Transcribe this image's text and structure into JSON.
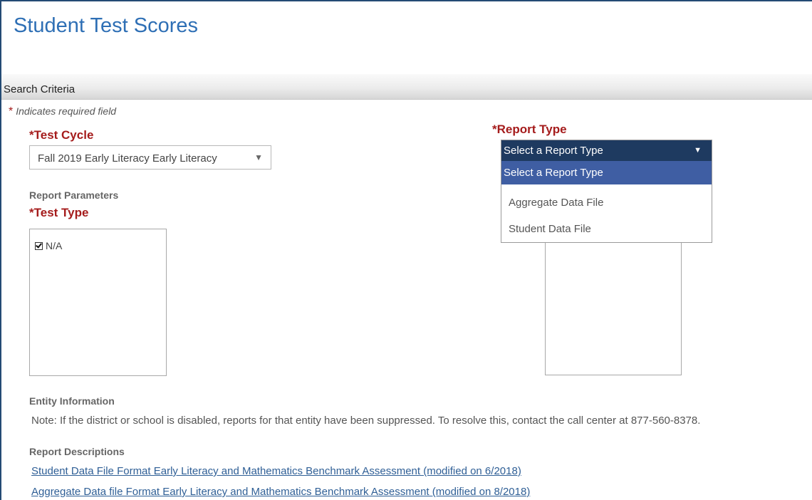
{
  "page": {
    "title": "Student Test Scores"
  },
  "section": {
    "title": "Search Criteria"
  },
  "required_note": {
    "star": "*",
    "text": "Indicates required field"
  },
  "test_cycle": {
    "label": "*Test Cycle",
    "selected": "Fall 2019 Early Literacy Early Literacy",
    "arrow_icon": "▼"
  },
  "report_parameters": {
    "heading": "Report Parameters"
  },
  "test_type": {
    "label": "*Test Type",
    "items": [
      {
        "label": "N/A",
        "checked": true
      }
    ]
  },
  "report_type": {
    "label": "*Report Type",
    "selected": "Select a Report Type",
    "arrow_icon": "▼",
    "options": [
      "Select a Report Type",
      "Aggregate Data File",
      "Student Data File"
    ]
  },
  "entity_information": {
    "heading": "Entity Information",
    "note": "Note: If the district or school is disabled, reports for that entity have been suppressed. To resolve this, contact the call center at 877-560-8378."
  },
  "report_descriptions": {
    "heading": "Report Descriptions",
    "links": [
      "Student Data File Format Early Literacy and Mathematics Benchmark Assessment (modified on 6/2018)",
      "Aggregate Data file Format Early Literacy and Mathematics Benchmark Assessment (modified on 8/2018)"
    ]
  },
  "colors": {
    "title_blue": "#2e6fb5",
    "required_red": "#a51c1c",
    "dropdown_header": "#1e3a60",
    "dropdown_selected": "#3f5ea3",
    "link": "#2f5f96"
  }
}
